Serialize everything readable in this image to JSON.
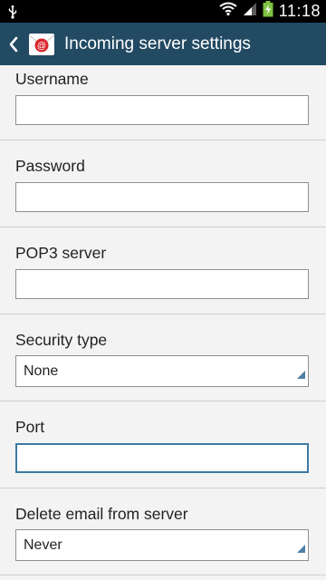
{
  "status_bar": {
    "time": "11:18",
    "icons": [
      "usb-icon",
      "wifi-icon",
      "signal-icon",
      "battery-charging-icon"
    ]
  },
  "action_bar": {
    "title": "Incoming server settings",
    "back_icon": "chevron-left-icon",
    "app_icon": "email-app-icon"
  },
  "form": {
    "username": {
      "label": "Username",
      "value": ""
    },
    "password": {
      "label": "Password",
      "value": ""
    },
    "pop3_server": {
      "label": "POP3 server",
      "value": ""
    },
    "security_type": {
      "label": "Security type",
      "value": "None"
    },
    "port": {
      "label": "Port",
      "value": ""
    },
    "delete_email": {
      "label": "Delete email from server",
      "value": "Never"
    }
  },
  "colors": {
    "action_bar": "#224a63",
    "focus_border": "#3c7aa3",
    "background": "#f3f3f3"
  }
}
